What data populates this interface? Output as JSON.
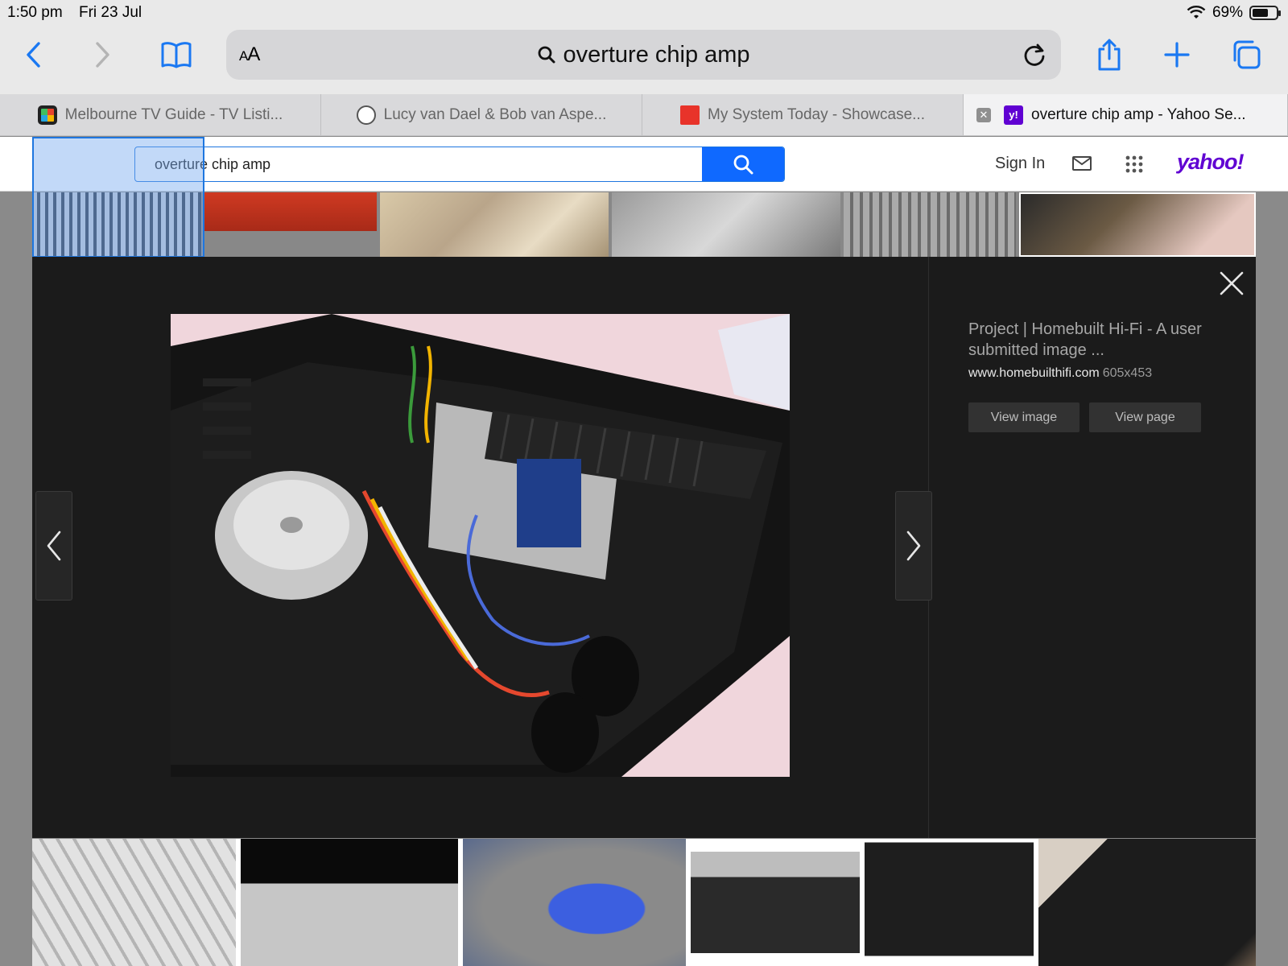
{
  "status_bar": {
    "time": "1:50 pm",
    "date": "Fri 23 Jul",
    "battery": "69%",
    "battery_level": 0.69
  },
  "toolbar": {
    "aa_small": "A",
    "aa_large": "A",
    "url_query": "overture chip amp"
  },
  "tabs": [
    {
      "label": "Melbourne TV Guide - TV Listi...",
      "icon": "tv-guide-favicon",
      "color": "#e8442d"
    },
    {
      "label": "Lucy van Dael & Bob van Aspe...",
      "icon": "clock-favicon",
      "color": "#555555"
    },
    {
      "label": "My System Today - Showcase...",
      "icon": "showcase-favicon",
      "color": "#e8332a"
    },
    {
      "label": "overture chip amp - Yahoo Se...",
      "icon": "yahoo-favicon",
      "color": "#6001d2",
      "active": true
    }
  ],
  "yahoo": {
    "search_value": "overture chip amp",
    "sign_in": "Sign In",
    "logo": "yahoo!",
    "brand_color": "#6001d2",
    "search_button_color": "#0f69ff"
  },
  "lightbox": {
    "title": "Project | Homebuilt Hi-Fi - A user submitted image ...",
    "source_domain": "www.homebuilthifi.com",
    "dimensions": "605x453",
    "view_image": "View image",
    "view_page": "View page"
  }
}
